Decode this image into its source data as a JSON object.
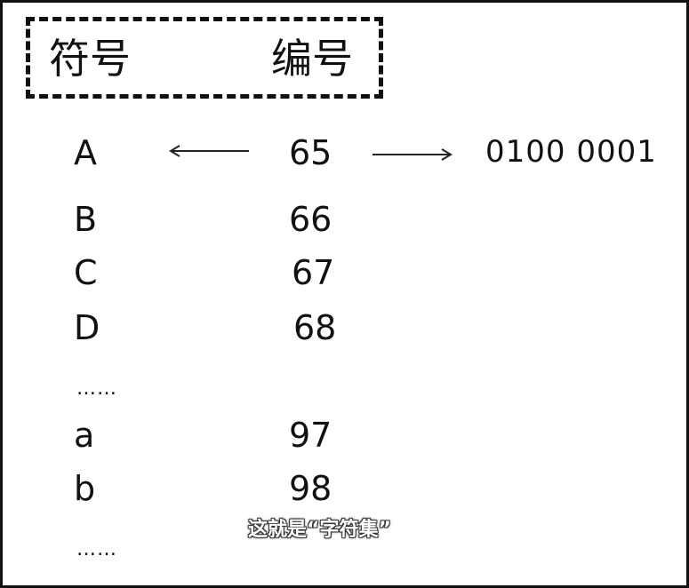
{
  "header": {
    "symbol_label": "符号",
    "number_label": "编号"
  },
  "rows": [
    {
      "symbol": "A",
      "number": "65"
    },
    {
      "symbol": "B",
      "number": "66"
    },
    {
      "symbol": "C",
      "number": "67"
    },
    {
      "symbol": "D",
      "number": "68"
    },
    {
      "symbol": "a",
      "number": "97"
    },
    {
      "symbol": "b",
      "number": "98"
    }
  ],
  "ellipsis_1": "……",
  "ellipsis_2": "……",
  "binary_A": "0100 0001",
  "subtitle": "这就是“字符集”",
  "arrows": {
    "left": "left-arrow-icon",
    "right": "right-arrow-icon"
  }
}
